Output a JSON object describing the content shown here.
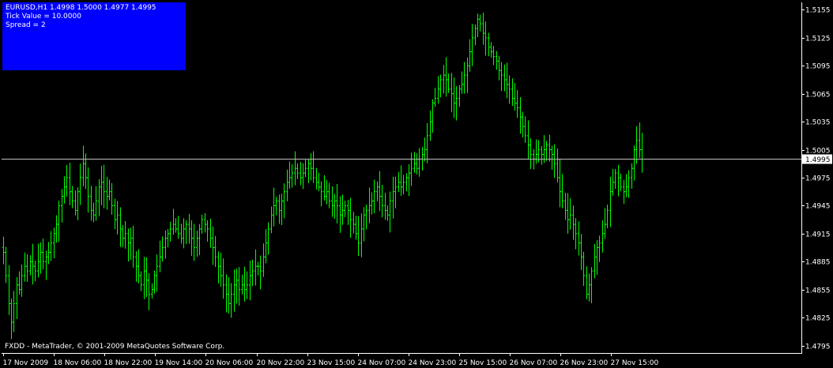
{
  "info": {
    "symbol_line": "EURUSD,H1  1.4998 1.5000 1.4977 1.4995",
    "tick_value": "Tick Value = 10.0000",
    "spread": "Spread = 2"
  },
  "copyright": "FXDD - MetaTrader, © 2001-2009 MetaQuotes Software Corp.",
  "colors": {
    "background": "#000000",
    "bars": "#00ff00",
    "axis": "#ffffff",
    "info_panel": "#0000ff",
    "bid_line": "#c0c0c0"
  },
  "chart_data": {
    "type": "ohlc",
    "symbol": "EURUSD",
    "timeframe": "H1",
    "current_price": 1.4995,
    "ylim": [
      1.4787,
      1.5163
    ],
    "y_ticks": [
      "1.5155",
      "1.5125",
      "1.5095",
      "1.5065",
      "1.5035",
      "1.5005",
      "1.4975",
      "1.4945",
      "1.4915",
      "1.4885",
      "1.4855",
      "1.4825",
      "1.4795"
    ],
    "x_ticks": [
      "17 Nov 2009",
      "18 Nov 06:00",
      "18 Nov 22:00",
      "19 Nov 14:00",
      "20 Nov 06:00",
      "20 Nov 22:00",
      "23 Nov 15:00",
      "24 Nov 07:00",
      "24 Nov 23:00",
      "25 Nov 15:00",
      "26 Nov 07:00",
      "26 Nov 23:00",
      "27 Nov 15:00"
    ],
    "bars_start_time": "17 Nov 2009 00:00",
    "bar_interval_hours": 1,
    "bar_session_breaks": [
      {
        "after_index": 174,
        "resumes": "23 Nov 00:00"
      }
    ],
    "close_series": [
      1.4895,
      1.487,
      1.484,
      1.482,
      1.484,
      1.486,
      1.4855,
      1.487,
      1.488,
      1.4875,
      1.4885,
      1.488,
      1.4875,
      1.4885,
      1.4895,
      1.4885,
      1.489,
      1.4895,
      1.4905,
      1.4915,
      1.4925,
      1.4945,
      1.4955,
      1.4965,
      1.4975,
      1.496,
      1.495,
      1.494,
      1.496,
      1.4975,
      1.499,
      1.4975,
      1.4955,
      1.494,
      1.4935,
      1.495,
      1.4965,
      1.497,
      1.496,
      1.4955,
      1.496,
      1.4945,
      1.493,
      1.4935,
      1.492,
      1.491,
      1.4915,
      1.4905,
      1.491,
      1.489,
      1.488,
      1.487,
      1.486,
      1.4875,
      1.4865,
      1.485,
      1.4855,
      1.487,
      1.488,
      1.489,
      1.49,
      1.491,
      1.4915,
      1.492,
      1.4925,
      1.492,
      1.4915,
      1.491,
      1.492,
      1.4925,
      1.492,
      1.491,
      1.49,
      1.491,
      1.492,
      1.493,
      1.4925,
      1.492,
      1.491,
      1.49,
      1.489,
      1.488,
      1.487,
      1.486,
      1.485,
      1.484,
      1.485,
      1.486,
      1.4865,
      1.4855,
      1.486,
      1.4855,
      1.486,
      1.487,
      1.4875,
      1.488,
      1.488,
      1.4875,
      1.489,
      1.4905,
      1.492,
      1.4935,
      1.4945,
      1.495,
      1.494,
      1.495,
      1.496,
      1.497,
      1.4975,
      1.498,
      1.4985,
      1.498,
      1.4975,
      1.498,
      1.4985,
      1.499,
      1.4985,
      1.4975,
      1.497,
      1.4965,
      1.496,
      1.4955,
      1.496,
      1.495,
      1.4945,
      1.495,
      1.4945,
      1.4935,
      1.494,
      1.4945,
      1.494,
      1.493,
      1.4925,
      1.4915,
      1.4905,
      1.492,
      1.4935,
      1.494,
      1.4945,
      1.495,
      1.496,
      1.4965,
      1.4955,
      1.4945,
      1.494,
      1.4935,
      1.495,
      1.496,
      1.4965,
      1.497,
      1.4965,
      1.497,
      1.4975,
      1.498,
      1.4985,
      1.499,
      1.4985,
      1.4995,
      1.5,
      1.5005,
      1.502,
      1.5035,
      1.5055,
      1.506,
      1.507,
      1.508,
      1.5085,
      1.508,
      1.507,
      1.5065,
      1.5055,
      1.506,
      1.507,
      1.5075,
      1.5085,
      1.5095,
      1.511,
      1.5125,
      1.5135,
      1.5145,
      1.514,
      1.513,
      1.5125,
      1.5115,
      1.511,
      1.5105,
      1.51,
      1.509,
      1.5085,
      1.508,
      1.5075,
      1.507,
      1.506,
      1.5055,
      1.505,
      1.504,
      1.503,
      1.502,
      1.501,
      1.5,
      1.4995,
      1.5,
      1.5005,
      1.5,
      1.5005,
      1.501,
      1.5005,
      1.5,
      1.499,
      1.4975,
      1.496,
      1.495,
      1.494,
      1.493,
      1.4935,
      1.4925,
      1.4915,
      1.4905,
      1.489,
      1.487,
      1.485,
      1.486,
      1.4875,
      1.489,
      1.49,
      1.4905,
      1.4915,
      1.4925,
      1.494,
      1.496,
      1.497,
      1.498,
      1.4975,
      1.4965,
      1.496,
      1.4965,
      1.4975,
      1.4985,
      1.5005,
      1.5015,
      1.5005,
      1.4995
    ]
  }
}
